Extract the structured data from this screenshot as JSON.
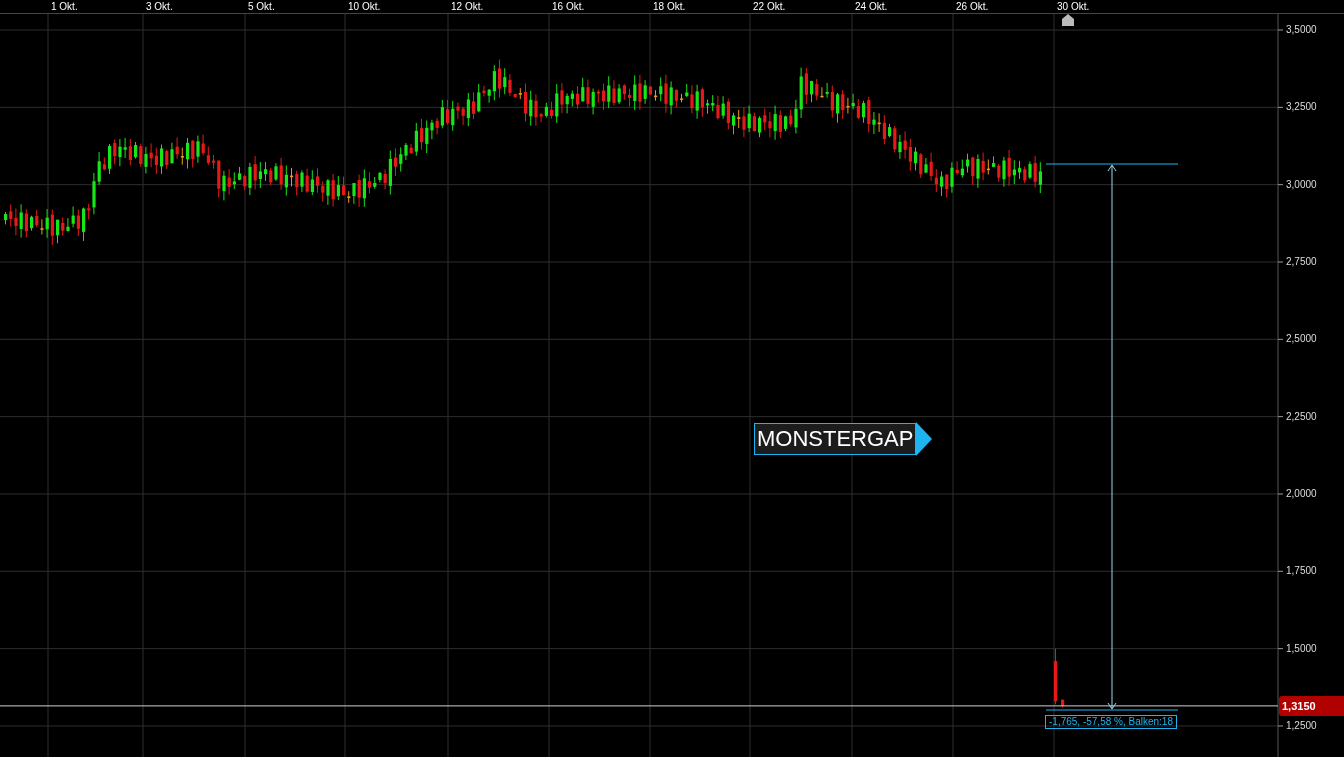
{
  "x_axis": {
    "labels": [
      "1 Okt.",
      "3 Okt.",
      "5 Okt.",
      "10 Okt.",
      "12 Okt.",
      "16 Okt.",
      "18 Okt.",
      "22 Okt.",
      "24 Okt.",
      "26 Okt.",
      "30 Okt."
    ]
  },
  "y_axis": {
    "labels": [
      "3,5000",
      "3,2500",
      "3,0000",
      "2,7500",
      "2,5000",
      "2,2500",
      "2,0000",
      "1,7500",
      "1,5000",
      "1,2500"
    ]
  },
  "current_price": "1,3150",
  "annotation": {
    "text": "MONSTERGAP"
  },
  "measurement": {
    "text": "-1,765, -57,58 %, Balken:18"
  }
}
